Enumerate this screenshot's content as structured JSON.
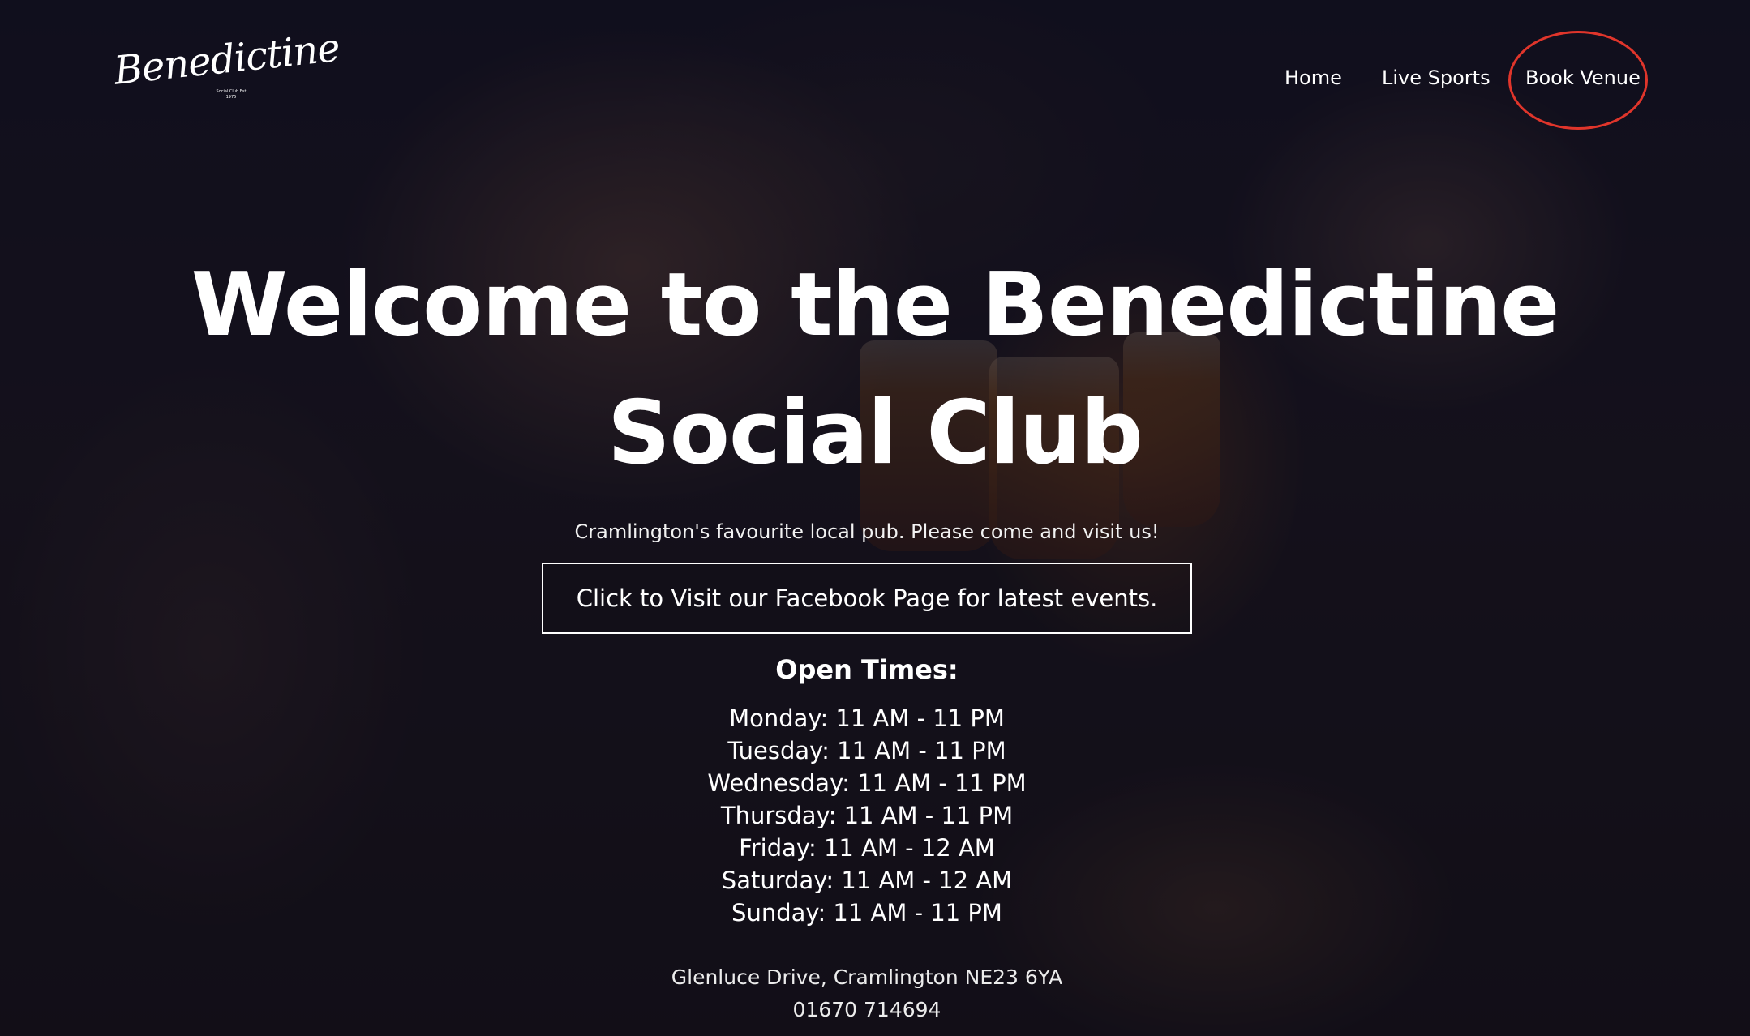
{
  "brand": {
    "logo_text": "Benedictine",
    "logo_subtext": "Social Club Est 1975"
  },
  "nav": {
    "items": [
      {
        "label": "Home"
      },
      {
        "label": "Live Sports"
      },
      {
        "label": "Book Venue"
      }
    ],
    "highlighted_item": "Book Venue",
    "highlight_color": "#e0352b"
  },
  "hero": {
    "title": "Welcome to the Benedictine Social Club",
    "tagline": "Cramlington's favourite local pub. Please come and visit us!",
    "cta_label": "Click to Visit our Facebook Page for latest events."
  },
  "open_times": {
    "heading": "Open Times:",
    "days": [
      "Monday: 11 AM - 11 PM",
      "Tuesday: 11 AM - 11 PM",
      "Wednesday: 11 AM - 11 PM",
      "Thursday: 11 AM - 11 PM",
      "Friday: 11 AM - 12 AM",
      "Saturday: 11 AM - 12 AM",
      "Sunday: 11 AM - 11 PM"
    ]
  },
  "contact": {
    "address": "Glenluce Drive, Cramlington NE23 6YA",
    "phone": "01670 714694"
  }
}
